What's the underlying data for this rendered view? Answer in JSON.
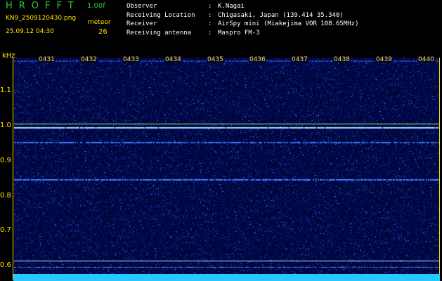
{
  "header": {
    "app_title": "HROFFT",
    "version": "1.00f",
    "filename": "KN9_2509120430.png",
    "timestamp": "25.09.12 04:30",
    "meteor_label": "meteor",
    "meteor_count": "26",
    "info": [
      {
        "key": "Observer",
        "sep": ":",
        "value": "K.Nagai"
      },
      {
        "key": "Receiving Location",
        "sep": ":",
        "value": "Chigasaki, Japan (139.414 35.340)"
      },
      {
        "key": "Receiver",
        "sep": ":",
        "value": "AirSpy mini (Miakejima VOR 108.65MHz)"
      },
      {
        "key": "Receiving antenna",
        "sep": ":",
        "value": "Maspro FM-3"
      }
    ]
  },
  "axis": {
    "unit": "kHz",
    "yticks": [
      "1.1",
      "1.0",
      "0.9",
      "0.8",
      "0.7",
      "0.6"
    ],
    "time_marks": [
      "0431",
      "0432",
      "0433",
      "0434",
      "0435",
      "0436",
      "0437",
      "0438",
      "0439",
      "0440"
    ]
  },
  "colors": {
    "background": "#000000",
    "plot_bg": "#00063a",
    "accent_yellow": "#ffe000",
    "title_green": "#2ecc2e",
    "bottom_bar": "#25c8ff"
  }
}
